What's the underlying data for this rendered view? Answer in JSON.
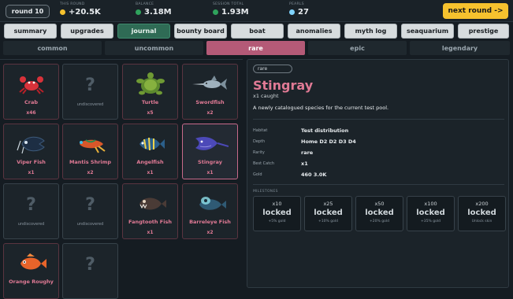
{
  "top": {
    "round": "round 10",
    "this_round": {
      "label": "THIS ROUND",
      "value": "+20.5K",
      "color": "#f6c22e"
    },
    "balance": {
      "label": "BALANCE",
      "value": "3.18M",
      "color": "#2fa35c"
    },
    "session_total": {
      "label": "SESSION TOTAL",
      "value": "1.93M",
      "color": "#2fa35c"
    },
    "pearls": {
      "label": "PEARLS",
      "value": "27",
      "color": "#7fd4ff"
    },
    "next_round": "next round ->"
  },
  "tabs": [
    "summary",
    "upgrades",
    "journal",
    "bounty board",
    "boat",
    "anomalies",
    "myth log",
    "seaquarium",
    "prestige"
  ],
  "active_tab": "journal",
  "rarity_tabs": [
    "common",
    "uncommon",
    "rare",
    "epic",
    "legendary"
  ],
  "active_rarity": "rare",
  "cards": [
    {
      "name": "Crab",
      "count": "x46",
      "icon": "crab-icon",
      "discovered": true
    },
    {
      "name": "?",
      "count": "undiscovered",
      "icon": "unknown-icon",
      "discovered": false
    },
    {
      "name": "Turtle",
      "count": "x5",
      "icon": "turtle-icon",
      "discovered": true
    },
    {
      "name": "Swordfish",
      "count": "x2",
      "icon": "swordfish-icon",
      "discovered": true
    },
    {
      "name": "Viper Fish",
      "count": "x1",
      "icon": "viper-fish-icon",
      "discovered": true
    },
    {
      "name": "Mantis Shrimp",
      "count": "x2",
      "icon": "mantis-shrimp-icon",
      "discovered": true
    },
    {
      "name": "Angelfish",
      "count": "x1",
      "icon": "angelfish-icon",
      "discovered": true
    },
    {
      "name": "Stingray",
      "count": "x1",
      "icon": "stingray-icon",
      "discovered": true,
      "selected": true
    },
    {
      "name": "?",
      "count": "undiscovered",
      "icon": "unknown-icon",
      "discovered": false
    },
    {
      "name": "?",
      "count": "undiscovered",
      "icon": "unknown-icon",
      "discovered": false
    },
    {
      "name": "Fangtooth Fish",
      "count": "x1",
      "icon": "fangtooth-fish-icon",
      "discovered": true
    },
    {
      "name": "Barreleye Fish",
      "count": "x2",
      "icon": "barreleye-fish-icon",
      "discovered": true
    },
    {
      "name": "Orange Roughy",
      "count": "",
      "icon": "orange-roughy-icon",
      "discovered": true
    },
    {
      "name": "?",
      "count": "",
      "icon": "unknown-icon",
      "discovered": false
    }
  ],
  "detail": {
    "rarity_pill": "rare",
    "title": "Stingray",
    "caught": "x1 caught",
    "description": "A newly catalogued species for the current test pool.",
    "fields": [
      {
        "label": "Habitat",
        "value": "Test distribution"
      },
      {
        "label": "Depth",
        "value": "Home D2   D2 D3 D4"
      },
      {
        "label": "Rarity",
        "value": "rare"
      },
      {
        "label": "Best Catch",
        "value": "x1"
      },
      {
        "label": "Gold",
        "value": "460  3.0K"
      }
    ],
    "milestones_label": "MILESTONES",
    "milestones": [
      {
        "count": "x10",
        "status": "locked",
        "reward": "+5% gold"
      },
      {
        "count": "x25",
        "status": "locked",
        "reward": "+10% gold"
      },
      {
        "count": "x50",
        "status": "locked",
        "reward": "+20% gold"
      },
      {
        "count": "x100",
        "status": "locked",
        "reward": "+35% gold"
      },
      {
        "count": "x200",
        "status": "locked",
        "reward": "Unlock skin"
      }
    ]
  }
}
